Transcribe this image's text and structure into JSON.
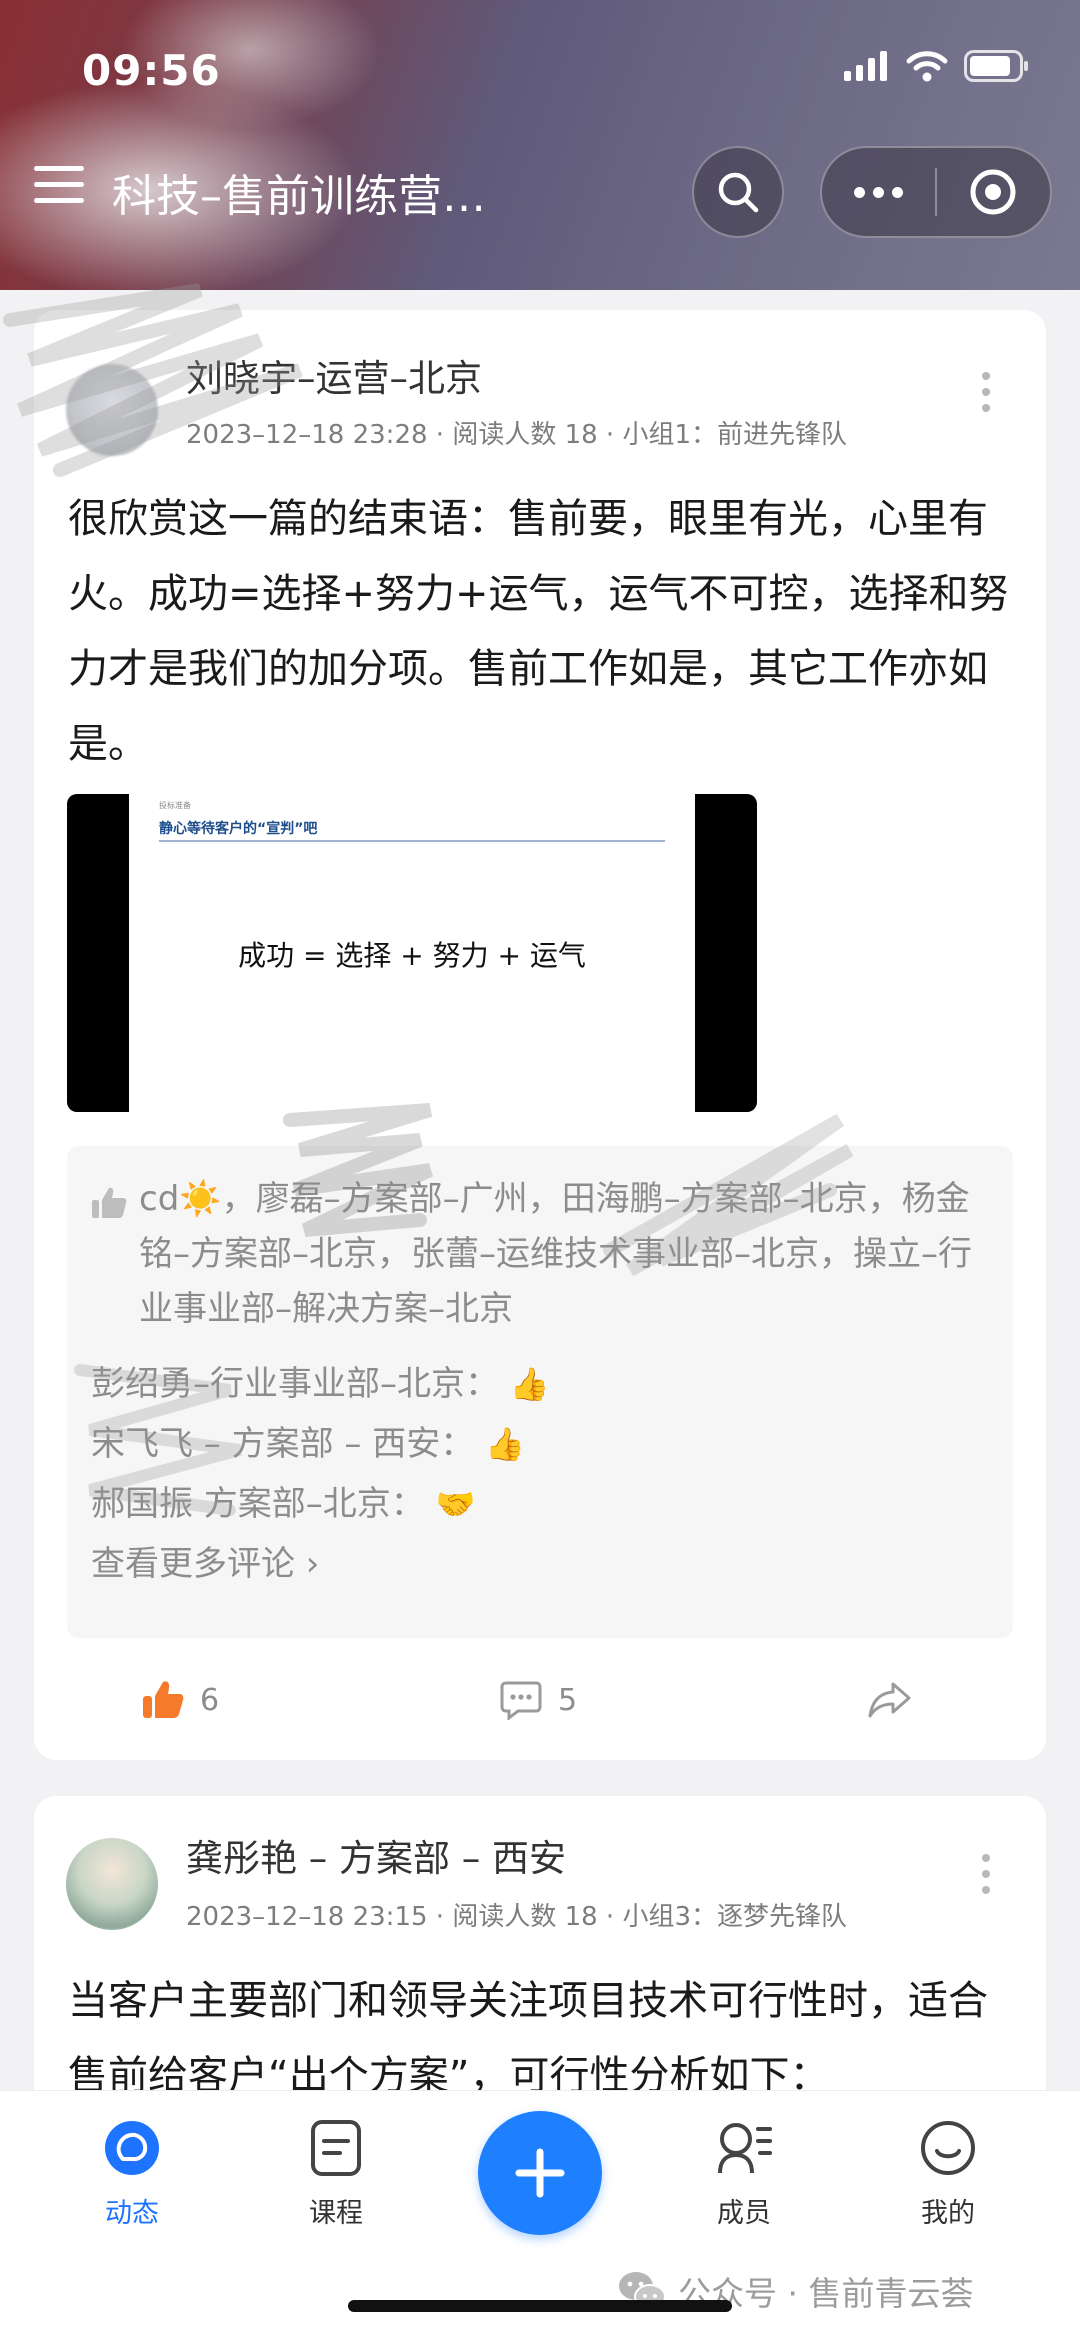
{
  "status_bar": {
    "time": "09:56"
  },
  "header": {
    "group_title": "科技–售前训练营…",
    "icons": [
      "menu-icon",
      "search-icon",
      "more-icon",
      "close-circle-icon"
    ]
  },
  "posts": [
    {
      "author": "刘晓宇–运营–北京",
      "meta": "2023–12–18 23:28 · 阅读人数 18 · 小组1：前进先锋队",
      "text": "很欣赏这一篇的结束语：售前要，眼里有光，心里有火。成功=选择+努力+运气，运气不可控，选择和努力才是我们的加分项。售前工作如是，其它工作亦如是。",
      "image": {
        "kicker": "投标准备",
        "heading": "静心等待客户的“宣判”吧",
        "body": "成功 = 选择 + 努力 + 运气"
      },
      "likers": "cd☀️，廖磊–方案部–广州，田海鹏–方案部–北京，杨金铭–方案部–北京，张蕾–运维技术事业部–北京，操立–行业事业部–解决方案–北京",
      "comments": [
        {
          "author": "彭绍勇–行业事业部–北京：",
          "emoji": "👍"
        },
        {
          "author": "宋飞飞 – 方案部 – 西安：",
          "emoji": "👍"
        },
        {
          "author": "郝国振 方案部–北京：",
          "emoji": "🤝"
        }
      ],
      "more_comments": "查看更多评论 ›",
      "like_count": "6",
      "comment_count": "5"
    },
    {
      "author": "龚彤艳 – 方案部 – 西安",
      "meta": "2023–12–18 23:15 · 阅读人数 18 · 小组3：逐梦先锋队",
      "text": "当客户主要部门和领导关注项目技术可行性时，适合售前给客户“出个方案”，可行性分析如下："
    }
  ],
  "tabbar": {
    "tabs": [
      {
        "label": "动态",
        "icon": "feed-icon",
        "active": true
      },
      {
        "label": "课程",
        "icon": "course-icon",
        "active": false
      },
      {
        "label": "成员",
        "icon": "members-icon",
        "active": false
      },
      {
        "label": "我的",
        "icon": "profile-icon",
        "active": false
      }
    ],
    "fab_icon": "plus-icon"
  },
  "watermark": "公众号 · 售前青云荟",
  "colors": {
    "accent": "#1e7fff",
    "like": "#f57b2a",
    "text_muted": "#8c8c8c"
  }
}
